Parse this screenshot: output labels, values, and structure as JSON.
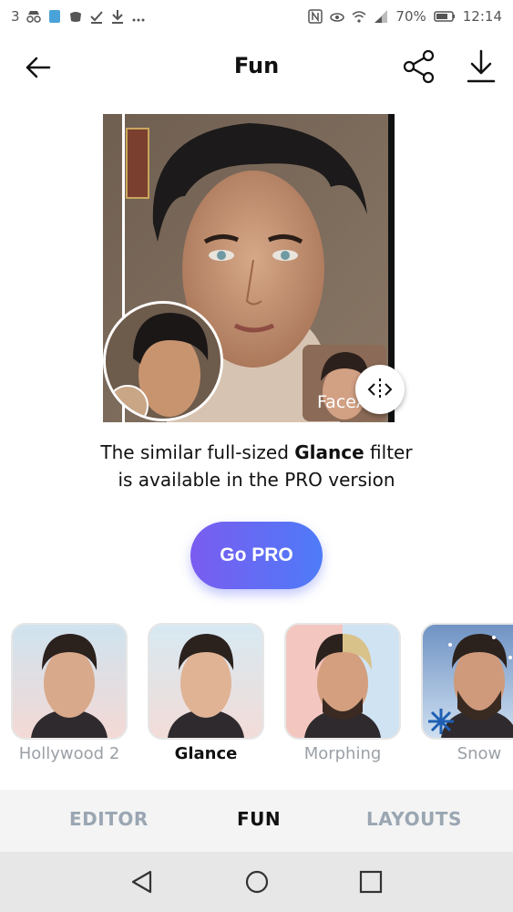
{
  "status_bar": {
    "left_count": "3",
    "battery": "70%",
    "time": "12:14",
    "icons_left": [
      "notification-icon",
      "browser-icon",
      "discord-icon",
      "check-icon",
      "download-icon",
      "more-icon"
    ],
    "icons_right": [
      "nfc-icon",
      "eye-icon",
      "wifi-icon",
      "signal-icon",
      "battery-icon"
    ]
  },
  "header": {
    "title": "Fun",
    "icons": [
      "back-arrow-icon",
      "share-icon",
      "download-icon"
    ]
  },
  "preview": {
    "watermark": "FaceApp",
    "compare_icon": "compare-arrows-icon"
  },
  "promo": {
    "line1_prefix": "The similar full-sized ",
    "line1_bold": "Glance",
    "line1_suffix": " filter",
    "line2": "is available in the PRO version"
  },
  "cta": {
    "label": "Go PRO"
  },
  "filters": [
    {
      "label": "Hollywood 2",
      "active": false
    },
    {
      "label": "Glance",
      "active": true
    },
    {
      "label": "Morphing",
      "active": false
    },
    {
      "label": "Snow",
      "active": false
    }
  ],
  "tabs": [
    {
      "label": "EDITOR",
      "active": false
    },
    {
      "label": "FUN",
      "active": true
    },
    {
      "label": "LAYOUTS",
      "active": false
    }
  ],
  "nav": {
    "icons": [
      "back-triangle-icon",
      "home-circle-icon",
      "recents-square-icon"
    ]
  },
  "colors": {
    "accent_start": "#7a5cf0",
    "accent_end": "#4e7bf8",
    "inactive_label": "#9aa0a6"
  }
}
